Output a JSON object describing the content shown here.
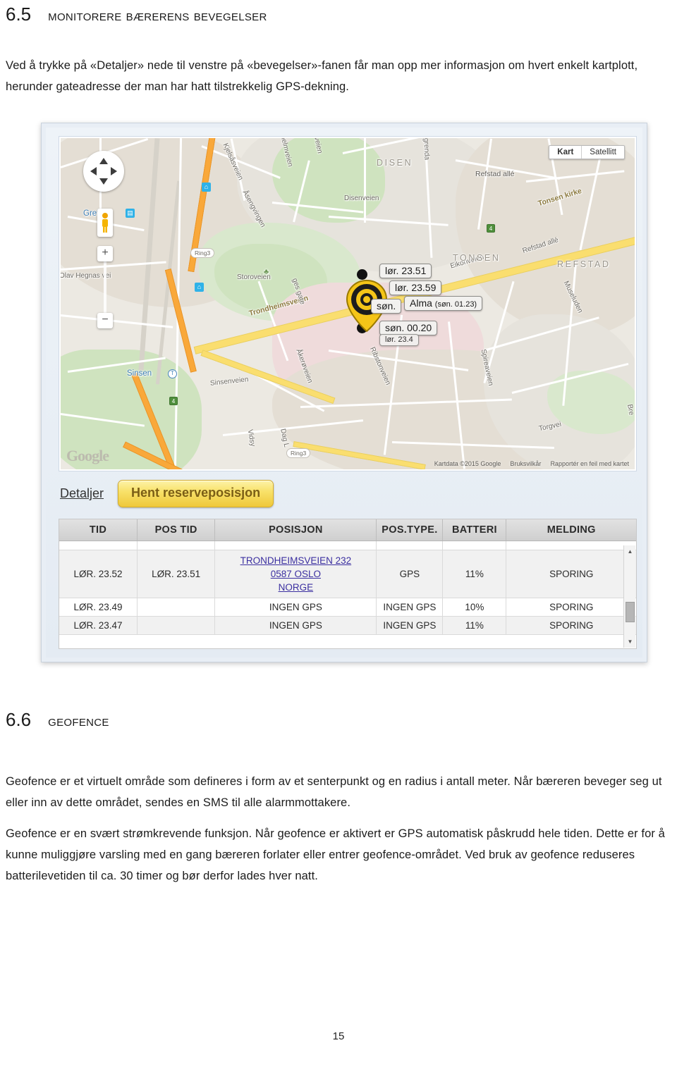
{
  "document": {
    "page_number": "15",
    "sections": [
      {
        "number": "6.5",
        "title": "Monitorere bærerens bevegelser"
      },
      {
        "number": "6.6",
        "title": "Geofence"
      }
    ],
    "intro_paragraph": "Ved å trykke på «Detaljer» nede til venstre på «bevegelser»-fanen får man opp mer informasjon om hvert enkelt kartplott, herunder gateadresse der man har hatt tilstrekkelig GPS-dekning.",
    "geofence_paragraph_1": "Geofence er et virtuelt område som defineres i form av et senterpunkt og en radius i antall meter. Når bæreren beveger seg ut eller inn av dette området, sendes en SMS til alle alarmmottakere.",
    "geofence_paragraph_2": "Geofence er en svært strømkrevende funksjon. Når geofence er aktivert er GPS automatisk påskrudd hele tiden. Dette er for å kunne muliggjøre varsling med en gang bæreren forlater eller entrer geofence-området. Ved bruk av geofence reduseres batterilevetiden til ca. 30 timer og bør derfor lades hver natt."
  },
  "screenshot": {
    "map": {
      "type_switch": {
        "map_label": "Kart",
        "satellite_label": "Satellitt",
        "selected": "Kart"
      },
      "logo": "Google",
      "attribution": [
        "Kartdata ©2015 Google",
        "Bruksvilkår",
        "Rapportér en feil med kartet"
      ],
      "area_labels": [
        "DISEN",
        "TONSEN",
        "REFSTAD"
      ],
      "street_labels": [
        "Kjelsåsveien",
        "Åsengvingen",
        "Disenveien",
        "grenda",
        "dalshelmveien",
        "lfveien",
        "Trondheimsveien",
        "Tonsen kirke",
        "Refstad allé",
        "Refstad allé",
        "Eikonveien",
        "Museluden",
        "Muselunden",
        "Storoveien",
        "ges gate",
        "Olav Hegnas vei",
        "Sinsenveien",
        "Åkerøveien",
        "Ribstonveien",
        "Spireaveien",
        "Torgvei",
        "Bre",
        "Vidsy",
        "Dag L"
      ],
      "station_labels": [
        "Grefsen",
        "Sinsen"
      ],
      "road_badges": [
        "Ring3",
        "Ring3",
        "4",
        "4"
      ],
      "controls": {
        "pan": "pan-control",
        "street_view": "pegman",
        "zoom_in": "+",
        "zoom_out": "−"
      },
      "tooltips": [
        {
          "text": "lør. 23.51"
        },
        {
          "text": "lør. 23.59"
        },
        {
          "text": "søn."
        },
        {
          "text": "Alma",
          "sub": "(søn. 01.23)"
        },
        {
          "text": "søn. 00.20"
        },
        {
          "text": "lør. 23.4"
        }
      ]
    },
    "toolbar": {
      "details_link": "Detaljer",
      "reserve_button": "Hent reserveposisjon"
    },
    "table": {
      "columns": [
        "TID",
        "POS TID",
        "POSISJON",
        "POS.TYPE.",
        "BATTERI",
        "MELDING"
      ],
      "rows": [
        {
          "tid": "LØR. 23.52",
          "pos_tid": "LØR. 23.51",
          "posisjon": [
            "TRONDHEIMSVEIEN 232",
            "0587 OSLO",
            "NORGE"
          ],
          "posisjon_is_link": true,
          "pos_type": "GPS",
          "batteri": "11%",
          "melding": "SPORING"
        },
        {
          "tid": "LØR. 23.49",
          "pos_tid": "",
          "posisjon": [
            "INGEN GPS"
          ],
          "posisjon_is_link": false,
          "pos_type": "INGEN GPS",
          "batteri": "10%",
          "melding": "SPORING"
        },
        {
          "tid": "LØR. 23.47",
          "pos_tid": "",
          "posisjon": [
            "INGEN GPS"
          ],
          "posisjon_is_link": false,
          "pos_type": "INGEN GPS",
          "batteri": "11%",
          "melding": "SPORING"
        }
      ]
    }
  },
  "colors": {
    "button_gold": "#efc83a",
    "link_blue": "#3b2fa0",
    "marker_yellow": "#f5c518",
    "road_major": "#f9a83a",
    "road_trunk": "#fade6f"
  }
}
